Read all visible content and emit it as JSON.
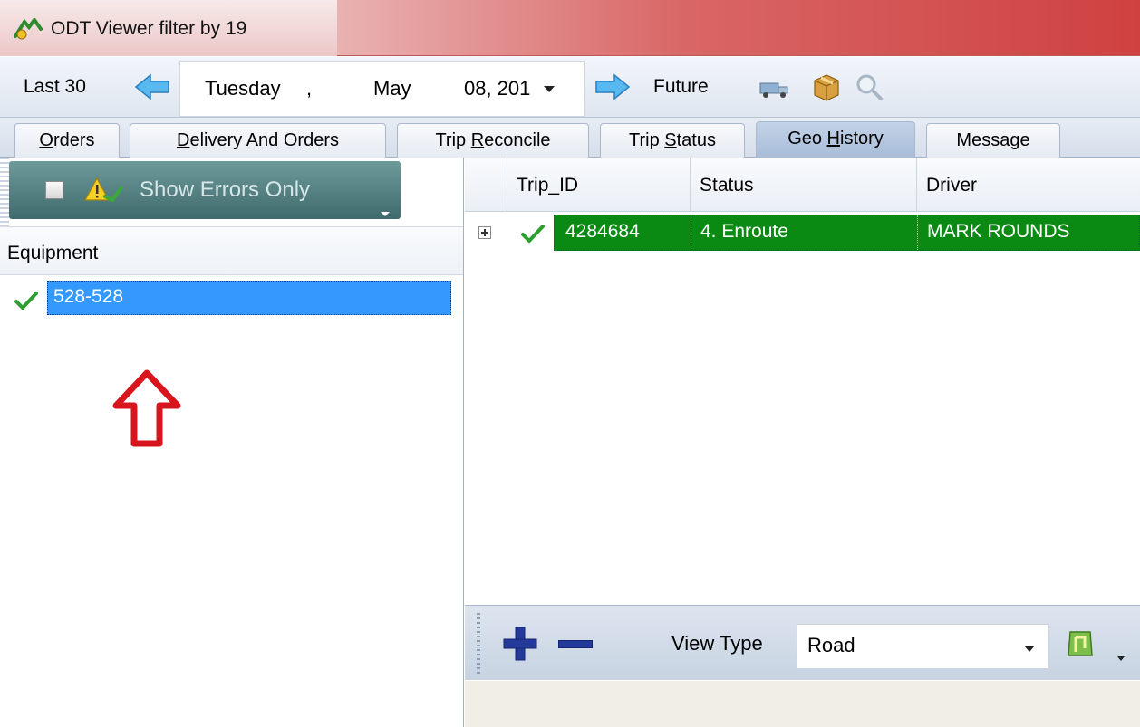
{
  "window": {
    "title": "ODT Viewer filter by 19"
  },
  "datebar": {
    "last_label": "Last 30",
    "date_day": "Tuesday",
    "date_sep": ",",
    "date_month": "May",
    "date_rest": "08, 201",
    "future_label": "Future"
  },
  "tabs": [
    {
      "pre": "",
      "hot": "O",
      "post": "rders"
    },
    {
      "pre": "",
      "hot": "D",
      "post": "elivery And Orders"
    },
    {
      "pre": "Trip ",
      "hot": "R",
      "post": "econcile"
    },
    {
      "pre": "Trip ",
      "hot": "S",
      "post": "tatus"
    },
    {
      "pre": "Geo ",
      "hot": "H",
      "post": "istory"
    },
    {
      "pre": "",
      "hot": "",
      "post": "Message"
    }
  ],
  "left": {
    "filter_label": "Show Errors Only",
    "equipment_header": "Equipment",
    "equipment_items": [
      "528-528"
    ]
  },
  "grid": {
    "columns": [
      "Trip_ID",
      "Status",
      "Driver"
    ],
    "rows": [
      {
        "trip_id": "4284684",
        "status": "4. Enroute",
        "driver": "MARK ROUNDS"
      }
    ]
  },
  "map": {
    "view_type_label": "View Type",
    "view_type_value": "Road"
  },
  "colors": {
    "selection_blue": "#3399ff",
    "row_green": "#0a8a12",
    "annotation_red": "#d8141c"
  }
}
